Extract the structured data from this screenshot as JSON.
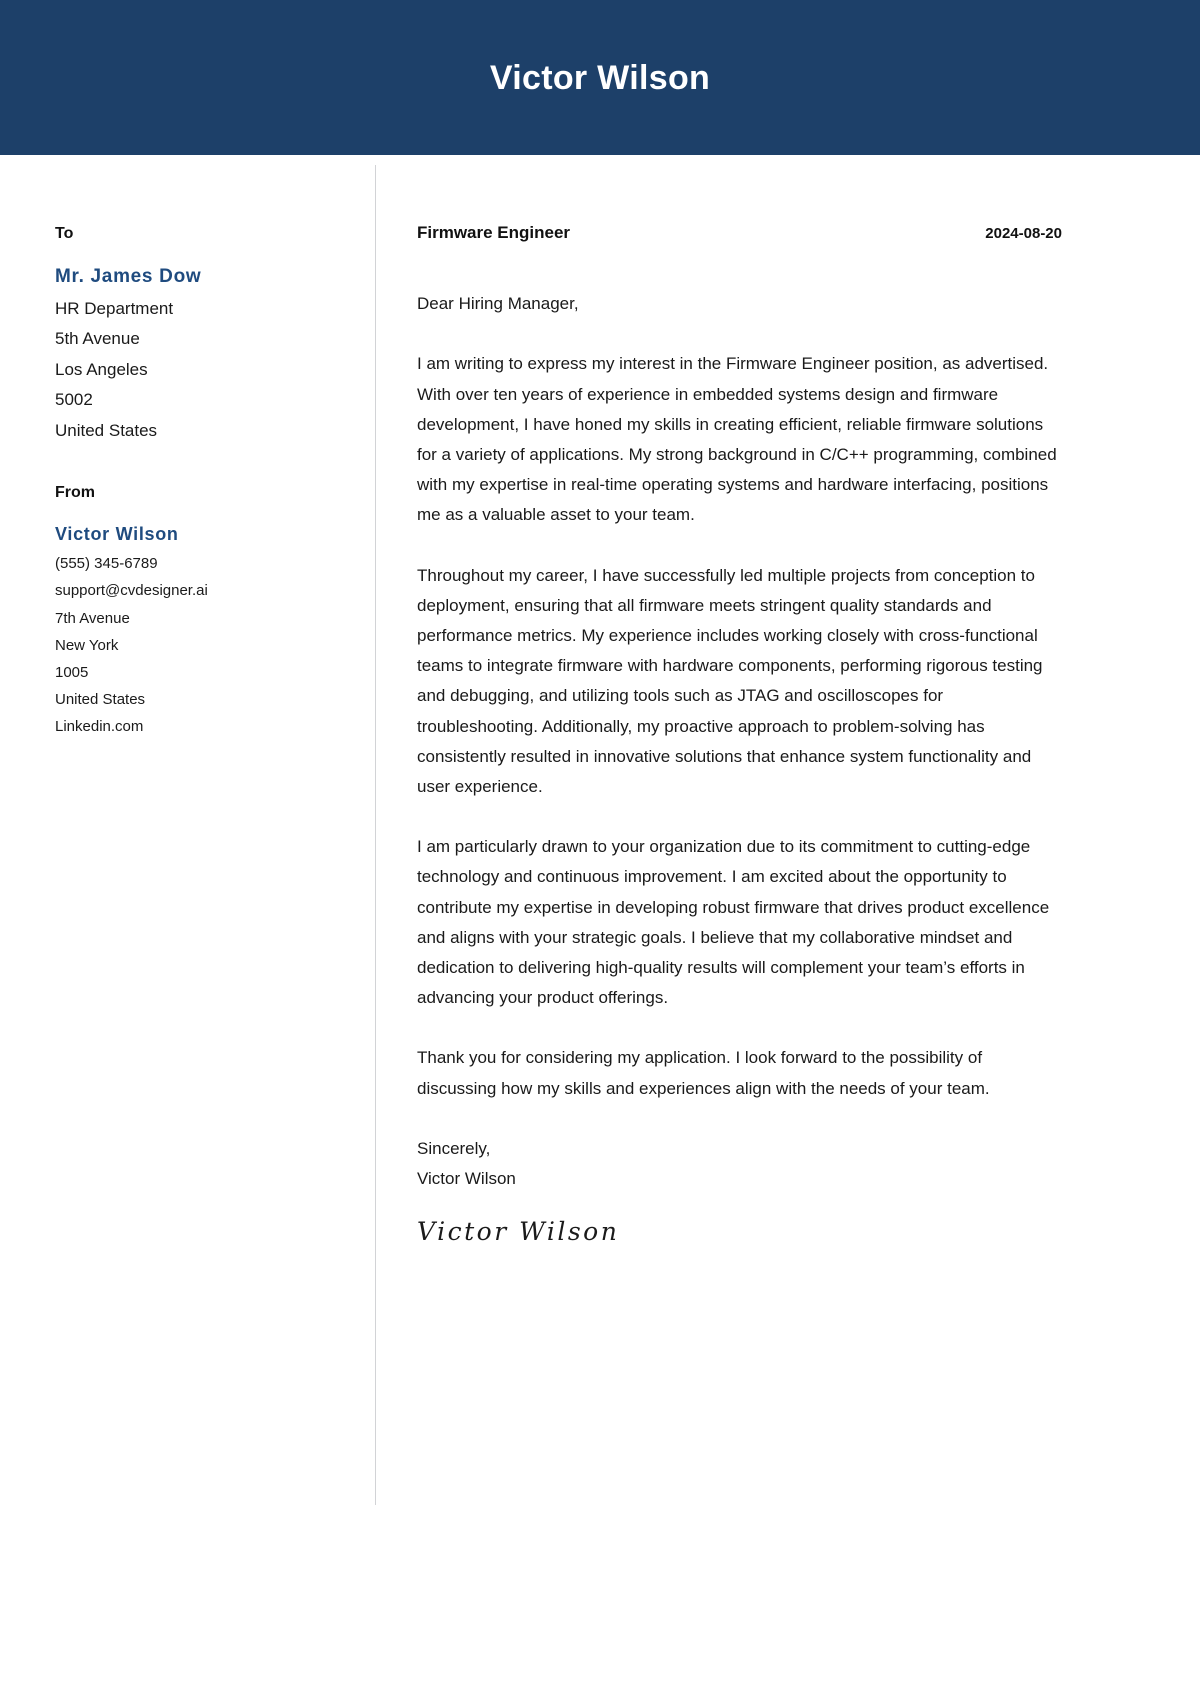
{
  "header": {
    "full_name": "Victor Wilson",
    "background_color": "#1d4069",
    "text_color": "#ffffff"
  },
  "sidebar": {
    "to": {
      "heading": "To",
      "recipient_name": "Mr. James Dow",
      "lines": [
        "HR Department",
        "5th Avenue",
        "Los Angeles",
        "5002",
        "United States"
      ]
    },
    "from": {
      "heading": "From",
      "sender_name": "Victor Wilson",
      "lines": [
        "(555) 345-6789",
        "support@cvdesigner.ai",
        "7th Avenue",
        "New York",
        "1005",
        "United States",
        "Linkedin.com"
      ]
    },
    "accent_color": "#1f4b7f"
  },
  "letter": {
    "job_title": "Firmware Engineer",
    "date": "2024-08-20",
    "salutation": "Dear Hiring Manager,",
    "paragraphs": [
      "I am writing to express my interest in the Firmware Engineer position, as advertised. With over ten years of experience in embedded systems design and firmware development, I have honed my skills in creating efficient, reliable firmware solutions for a variety of applications. My strong background in C/C++ programming, combined with my expertise in real-time operating systems and hardware interfacing, positions me as a valuable asset to your team.",
      "Throughout my career, I have successfully led multiple projects from conception to deployment, ensuring that all firmware meets stringent quality standards and performance metrics. My experience includes working closely with cross-functional teams to integrate firmware with hardware components, performing rigorous testing and debugging, and utilizing tools such as JTAG and oscilloscopes for troubleshooting. Additionally, my proactive approach to problem-solving has consistently resulted in innovative solutions that enhance system functionality and user experience.",
      "I am particularly drawn to your organization due to its commitment to cutting-edge technology and continuous improvement. I am excited about the opportunity to contribute my expertise in developing robust firmware that drives product excellence and aligns with your strategic goals. I believe that my collaborative mindset and dedication to delivering high-quality results will complement your team’s efforts in advancing your product offerings.",
      "Thank you for considering my application. I look forward to the possibility of discussing how my skills and experiences align with the needs of your team."
    ],
    "closing_phrase": "Sincerely,",
    "closing_name": "Victor Wilson",
    "signature": "Victor Wilson"
  }
}
